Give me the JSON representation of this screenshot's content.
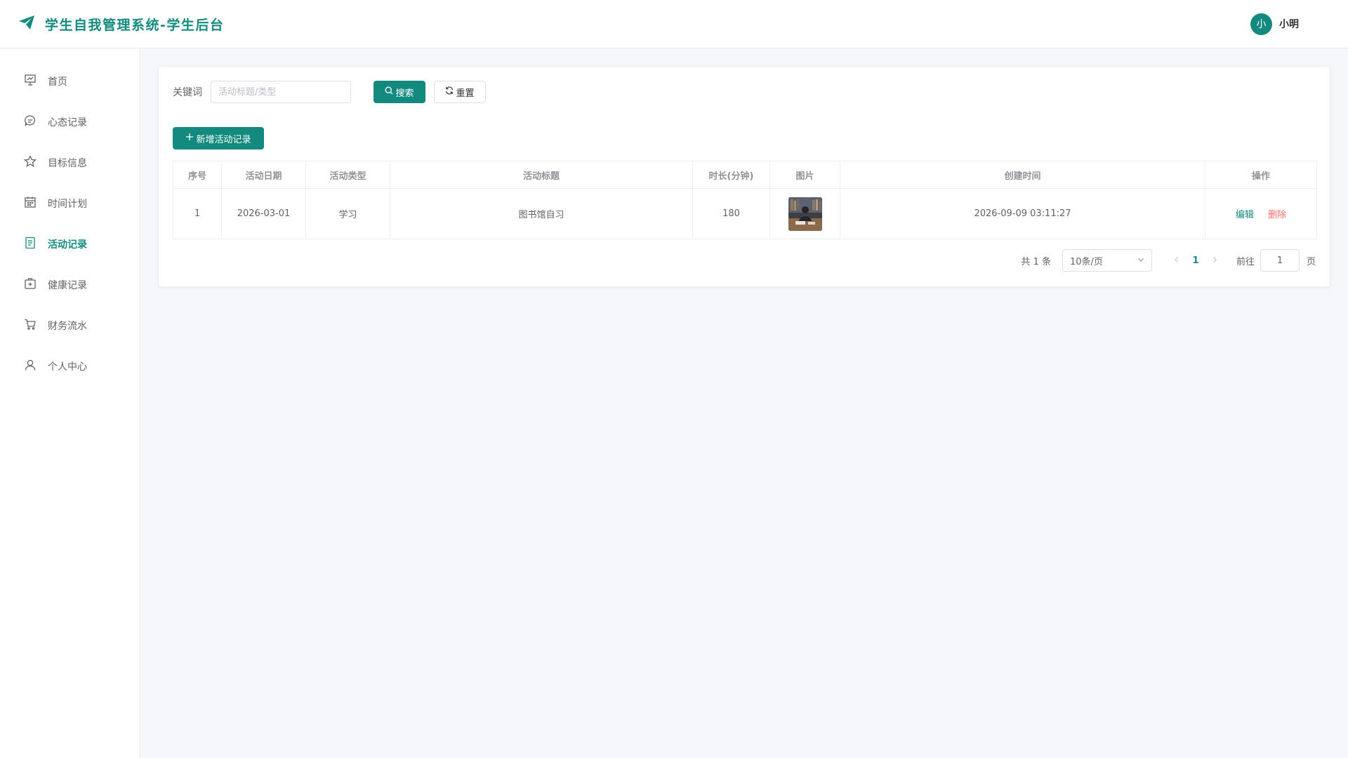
{
  "app": {
    "title": "学生自我管理系统-学生后台",
    "brand_color": "#138a7e",
    "brand_icon": "paper-plane-icon"
  },
  "user": {
    "avatar_text": "小",
    "name": "小明"
  },
  "sidebar": {
    "items": [
      {
        "label": "首页",
        "icon": "dashboard-icon",
        "active": false
      },
      {
        "label": "心态记录",
        "icon": "chat-bubble-icon",
        "active": false
      },
      {
        "label": "目标信息",
        "icon": "star-icon",
        "active": false
      },
      {
        "label": "时间计划",
        "icon": "calendar-icon",
        "active": false
      },
      {
        "label": "活动记录",
        "icon": "document-icon",
        "active": true
      },
      {
        "label": "健康记录",
        "icon": "first-aid-kit-icon",
        "active": false
      },
      {
        "label": "财务流水",
        "icon": "cart-icon",
        "active": false
      },
      {
        "label": "个人中心",
        "icon": "user-icon",
        "active": false
      }
    ]
  },
  "search": {
    "label": "关键词",
    "value": "",
    "placeholder": "活动标题/类型",
    "search_label": "搜索",
    "reset_label": "重置"
  },
  "toolbar": {
    "add_label": "新增活动记录"
  },
  "table": {
    "columns": [
      "序号",
      "活动日期",
      "活动类型",
      "活动标题",
      "时长(分钟)",
      "图片",
      "创建时间",
      "操作"
    ],
    "rows": [
      {
        "index": "1",
        "date": "2026-03-01",
        "type": "学习",
        "title": "图书馆自习",
        "duration": "180",
        "image": "library-study-photo",
        "created": "2026-09-09 03:11:27",
        "edit_label": "编辑",
        "delete_label": "删除"
      }
    ]
  },
  "pagination": {
    "total_text": "共 1 条",
    "page_size": "10条/页",
    "current_page": "1",
    "goto_label": "前往",
    "goto_value": "1",
    "page_suffix": "页"
  }
}
